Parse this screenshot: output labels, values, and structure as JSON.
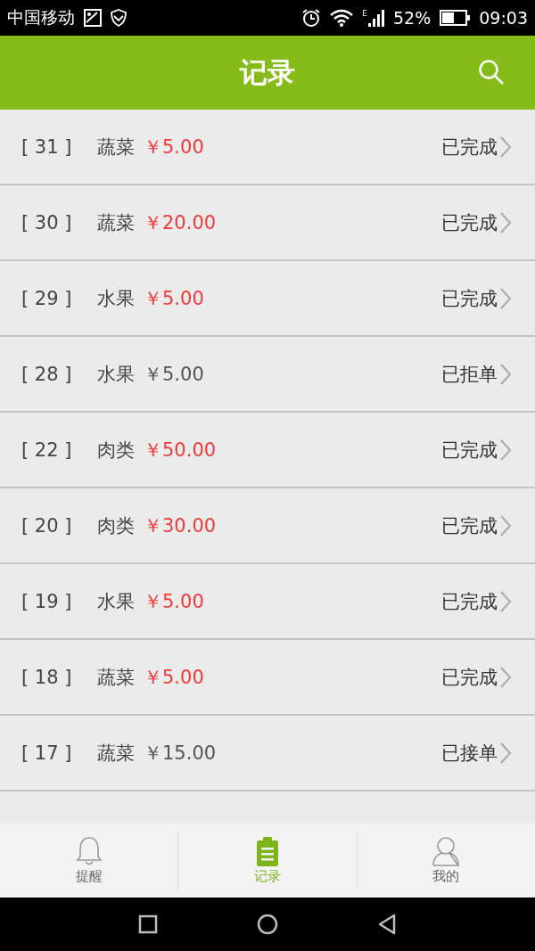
{
  "status_bar": {
    "carrier": "中国移动",
    "network": "E",
    "battery": "52%",
    "time": "09:03"
  },
  "header": {
    "title": "记录"
  },
  "records": [
    {
      "number": "[ 31 ]",
      "category": "蔬菜",
      "amount": "￥5.00",
      "highlighted": true,
      "status": "已完成"
    },
    {
      "number": "[ 30 ]",
      "category": "蔬菜",
      "amount": "￥20.00",
      "highlighted": true,
      "status": "已完成"
    },
    {
      "number": "[ 29 ]",
      "category": "水果",
      "amount": "￥5.00",
      "highlighted": true,
      "status": "已完成"
    },
    {
      "number": "[ 28 ]",
      "category": "水果",
      "amount": "￥5.00",
      "highlighted": false,
      "status": "已拒单"
    },
    {
      "number": "[ 22 ]",
      "category": "肉类",
      "amount": "￥50.00",
      "highlighted": true,
      "status": "已完成"
    },
    {
      "number": "[ 20 ]",
      "category": "肉类",
      "amount": "￥30.00",
      "highlighted": true,
      "status": "已完成"
    },
    {
      "number": "[ 19 ]",
      "category": "水果",
      "amount": "￥5.00",
      "highlighted": true,
      "status": "已完成"
    },
    {
      "number": "[ 18 ]",
      "category": "蔬菜",
      "amount": "￥5.00",
      "highlighted": true,
      "status": "已完成"
    },
    {
      "number": "[ 17 ]",
      "category": "蔬菜",
      "amount": "￥15.00",
      "highlighted": false,
      "status": "已接单"
    }
  ],
  "tabs": [
    {
      "kind": "bell",
      "label": "提醒",
      "selected": false
    },
    {
      "kind": "clipboard",
      "label": "记录",
      "selected": true
    },
    {
      "kind": "person",
      "label": "我的",
      "selected": false
    }
  ]
}
